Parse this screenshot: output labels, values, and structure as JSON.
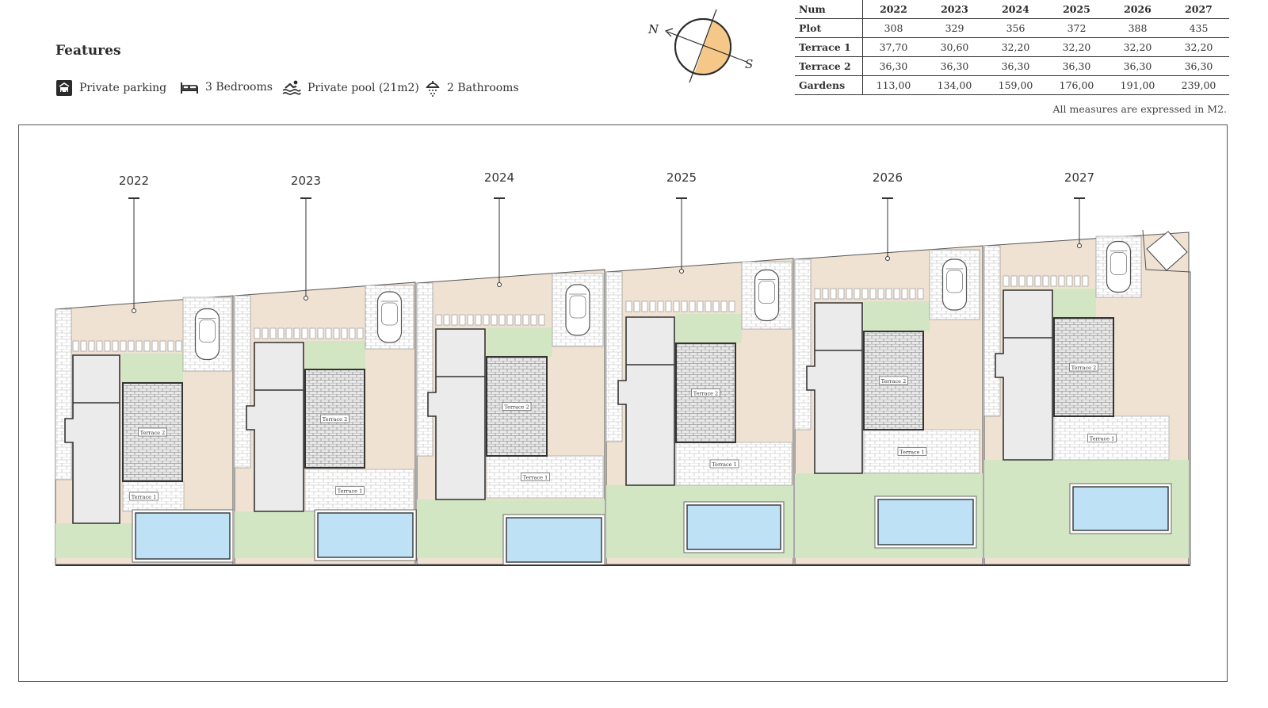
{
  "features": {
    "title": "Features",
    "items": [
      {
        "icon": "garage-icon",
        "label": "Private parking"
      },
      {
        "icon": "bed-icon",
        "label": "3 Bedrooms"
      },
      {
        "icon": "swimmer-icon",
        "label": "Private pool (21m2)"
      },
      {
        "icon": "shower-icon",
        "label": "2 Bathrooms"
      }
    ]
  },
  "compass": {
    "north": "N",
    "south": "S"
  },
  "table": {
    "header": [
      "Num",
      "2022",
      "2023",
      "2024",
      "2025",
      "2026",
      "2027"
    ],
    "rows": [
      {
        "label": "Plot",
        "values": [
          "308",
          "329",
          "356",
          "372",
          "388",
          "435"
        ]
      },
      {
        "label": "Terrace 1",
        "values": [
          "37,70",
          "30,60",
          "32,20",
          "32,20",
          "32,20",
          "32,20"
        ]
      },
      {
        "label": "Terrace 2",
        "values": [
          "36,30",
          "36,30",
          "36,30",
          "36,30",
          "36,30",
          "36,30"
        ]
      },
      {
        "label": "Gardens",
        "values": [
          "113,00",
          "134,00",
          "159,00",
          "176,00",
          "191,00",
          "239,00"
        ]
      }
    ],
    "note": "All measures are expressed in M2."
  },
  "plan": {
    "unit_labels": [
      "2022",
      "2023",
      "2024",
      "2025",
      "2026",
      "2027"
    ],
    "terrace1_label": "Terrace 1",
    "terrace2_label": "Terrace 2"
  },
  "colors": {
    "sand": "#f0e2d3",
    "grass": "#d3e6c3",
    "pool": "#bfe1f6",
    "house": "#ebebeb",
    "compass_fill": "#f5c88a"
  }
}
